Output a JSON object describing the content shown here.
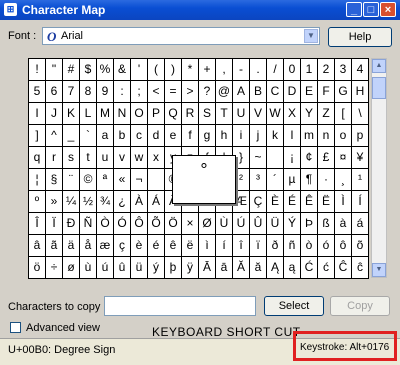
{
  "window": {
    "title": "Character Map",
    "app_icon": "character-map-icon"
  },
  "titlebar_buttons": {
    "minimize": "_",
    "maximize": "□",
    "close": "×"
  },
  "font": {
    "label": "Font :",
    "value": "Arial",
    "font_icon_glyph": "O"
  },
  "buttons": {
    "help": "Help",
    "select": "Select",
    "copy": "Copy"
  },
  "grid_rows": [
    [
      "!",
      "\"",
      "#",
      "$",
      "%",
      "&",
      "'",
      "(",
      ")",
      "*",
      "+",
      ",",
      "-",
      ".",
      "/",
      "0",
      "1",
      "2",
      "3",
      "4"
    ],
    [
      "5",
      "6",
      "7",
      "8",
      "9",
      ":",
      ";",
      "<",
      "=",
      ">",
      "?",
      "@",
      "A",
      "B",
      "C",
      "D",
      "E",
      "F",
      "G",
      "H"
    ],
    [
      "I",
      "J",
      "K",
      "L",
      "M",
      "N",
      "O",
      "P",
      "Q",
      "R",
      "S",
      "T",
      "U",
      "V",
      "W",
      "X",
      "Y",
      "Z",
      "[",
      "\\"
    ],
    [
      "]",
      "^",
      "_",
      "`",
      "a",
      "b",
      "c",
      "d",
      "e",
      "f",
      "g",
      "h",
      "i",
      "j",
      "k",
      "l",
      "m",
      "n",
      "o",
      "p"
    ],
    [
      "q",
      "r",
      "s",
      "t",
      "u",
      "v",
      "w",
      "x",
      "y",
      "z",
      "{",
      "|",
      "}",
      "~",
      "",
      "¡",
      "¢",
      "£",
      "¤",
      "¥"
    ],
    [
      "¦",
      "§",
      "¨",
      "©",
      "ª",
      "«",
      "¬",
      "­",
      "®",
      "¯",
      "°",
      "±",
      "²",
      "³",
      "´",
      "µ",
      "¶",
      "·",
      "¸",
      "¹"
    ],
    [
      "º",
      "»",
      "¼",
      "½",
      "¾",
      "¿",
      "À",
      "Á",
      "Â",
      "Ã",
      "Ä",
      "Å",
      "Æ",
      "Ç",
      "È",
      "É",
      "Ê",
      "Ë",
      "Ì",
      "Í"
    ],
    [
      "Î",
      "Ï",
      "Ð",
      "Ñ",
      "Ò",
      "Ó",
      "Ô",
      "Õ",
      "Ö",
      "×",
      "Ø",
      "Ù",
      "Ú",
      "Û",
      "Ü",
      "Ý",
      "Þ",
      "ß",
      "à",
      "á"
    ],
    [
      "â",
      "ã",
      "ä",
      "å",
      "æ",
      "ç",
      "è",
      "é",
      "ê",
      "ë",
      "ì",
      "í",
      "î",
      "ï",
      "ð",
      "ñ",
      "ò",
      "ó",
      "ô",
      "õ"
    ],
    [
      "ö",
      "÷",
      "ø",
      "ù",
      "ú",
      "û",
      "ü",
      "ý",
      "þ",
      "ÿ",
      "Ā",
      "ā",
      "Ă",
      "ă",
      "Ą",
      "ą",
      "Ć",
      "ć",
      "Ĉ",
      "ĉ"
    ]
  ],
  "selected_char": "°",
  "chars_to_copy": {
    "label": "Characters to copy",
    "value": ""
  },
  "advanced_view": {
    "label": "Advanced view",
    "checked": false
  },
  "overlay_text": "KEYBOARD SHORT CUT",
  "status": {
    "char_info": "U+00B0: Degree Sign",
    "keystroke": "Keystroke: Alt+0176"
  },
  "colors": {
    "title_bar": "#0a4ed3",
    "highlight": "#e02020"
  }
}
